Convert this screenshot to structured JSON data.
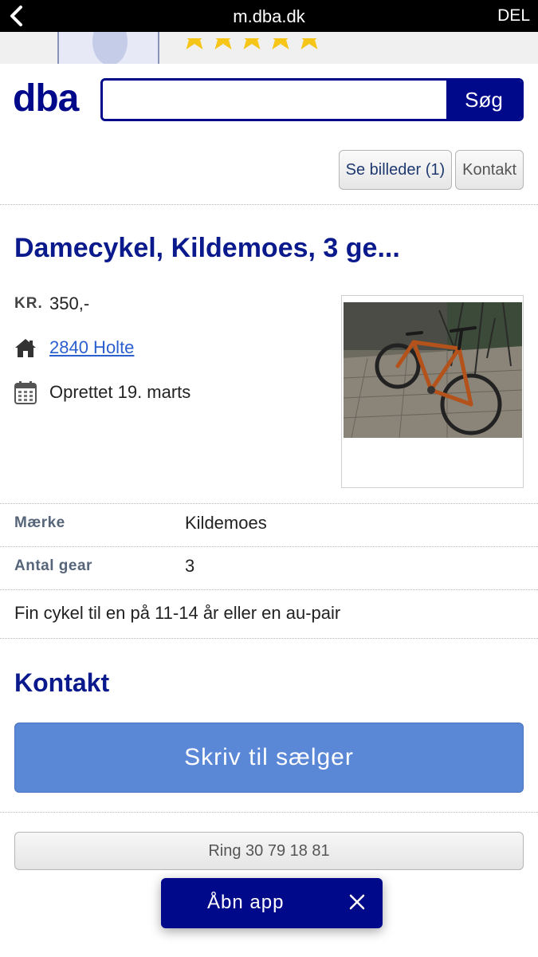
{
  "browser": {
    "host": "m.dba.dk",
    "share_label": "DEL"
  },
  "seller_strip": {
    "rating_stars": 5
  },
  "header": {
    "logo": "dba",
    "search_value": "",
    "search_button": "Søg"
  },
  "actions": {
    "images_button": "Se billeder (1)",
    "contact_button": "Kontakt"
  },
  "listing": {
    "title": "Damecykel, Kildemoes, 3 ge...",
    "currency_label": "KR.",
    "price": "350,-",
    "location": "2840 Holte",
    "created": "Oprettet 19. marts",
    "attributes": [
      {
        "label": "Mærke",
        "value": "Kildemoes"
      },
      {
        "label": "Antal gear",
        "value": "3"
      }
    ],
    "description": "Fin cykel til en på 11-14 år eller en au-pair"
  },
  "contact": {
    "heading": "Kontakt",
    "write_button": "Skriv til sælger",
    "call_button": "Ring 30 79 18 81"
  },
  "app_banner": {
    "label": "Åbn app"
  },
  "colors": {
    "brand": "#00098a",
    "primary_button": "#5a87d6",
    "link": "#2b5fcf",
    "star": "#f5c518"
  },
  "icons": {
    "back": "chevron-left-icon",
    "location": "house-icon",
    "created": "calendar-icon",
    "close": "close-icon"
  }
}
